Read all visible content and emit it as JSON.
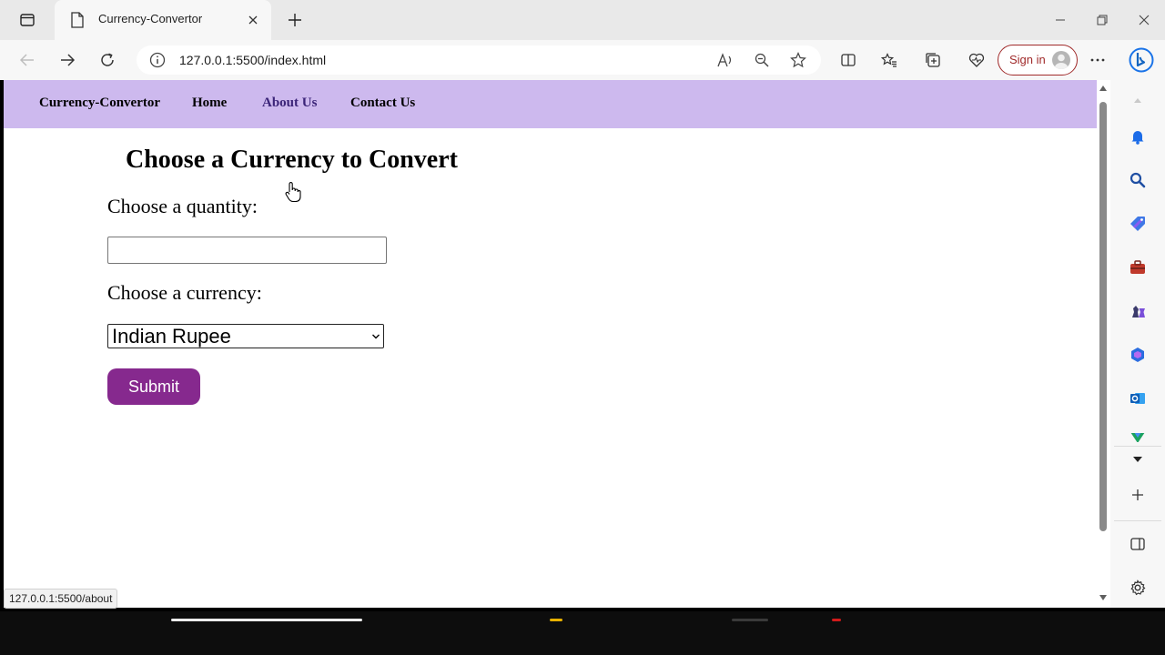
{
  "browser": {
    "tab": {
      "title": "Currency-Convertor"
    },
    "address": {
      "url": "127.0.0.1:5500/index.html"
    },
    "signin_label": "Sign in",
    "status_url": "127.0.0.1:5500/about"
  },
  "navbar": {
    "brand": "Currency-Convertor",
    "links": [
      "Home",
      "About Us",
      "Contact Us"
    ],
    "background": "#cdb9ee"
  },
  "main": {
    "heading": "Choose a Currency to Convert",
    "quantity_label": "Choose a quantity:",
    "quantity_value": "",
    "currency_label": "Choose a currency:",
    "currency_selected": "Indian Rupee",
    "submit_label": "Submit",
    "submit_color": "#86298e"
  },
  "sidebar_icons": [
    "bell-icon",
    "search-icon",
    "tag-icon",
    "briefcase-icon",
    "chess-icon",
    "office-icon",
    "outlook-icon",
    "drive-icon",
    "chevron-down-icon",
    "plus-icon",
    "panel-icon",
    "settings-icon"
  ]
}
